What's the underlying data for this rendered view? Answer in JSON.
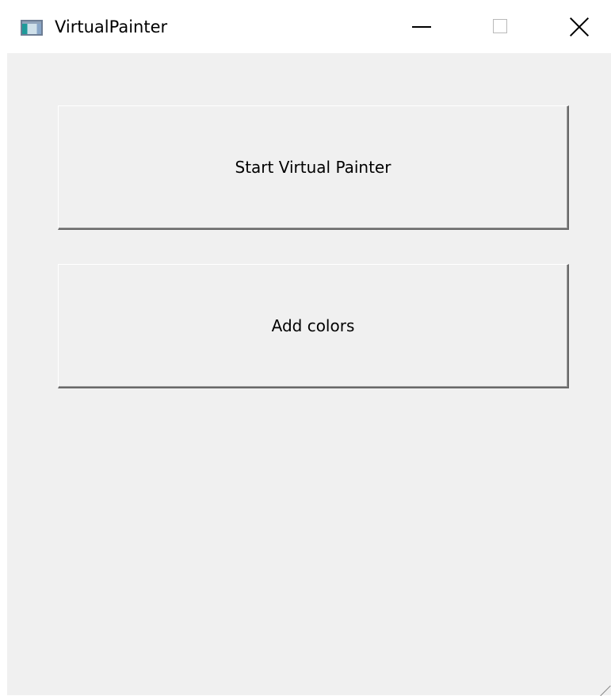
{
  "window": {
    "title": "VirtualPainter",
    "icon": "app-window-icon",
    "controls": {
      "minimize": "minimize-icon",
      "maximize": "maximize-icon",
      "close": "close-icon"
    }
  },
  "main": {
    "start_button_label": "Start Virtual Painter",
    "add_colors_button_label": "Add colors"
  },
  "colors": {
    "background": "#f0f0f0",
    "titlebar": "#ffffff"
  }
}
